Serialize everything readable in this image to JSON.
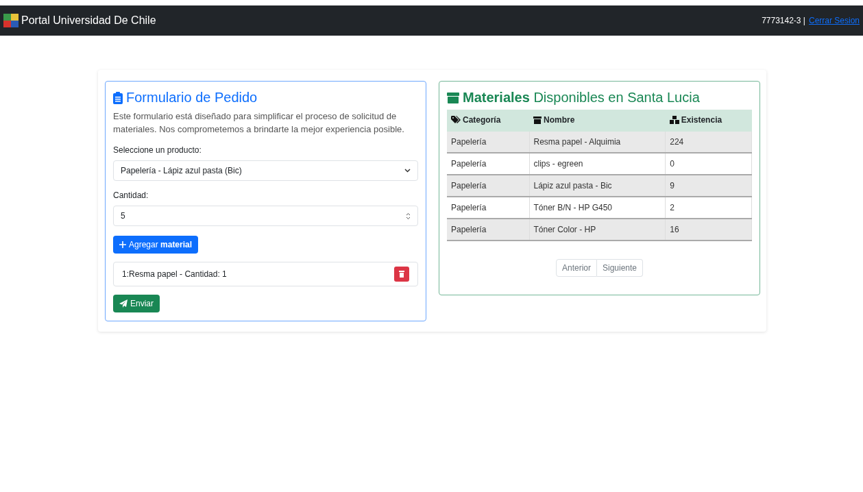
{
  "navbar": {
    "brand": "Portal Universidad De Chile",
    "user": "7773142-3 |",
    "logout": "Cerrar Sesion"
  },
  "form": {
    "title": "Formulario de Pedido",
    "description": "Este formulario está diseñado para simplificar el proceso de solicitud de materiales. Nos comprometemos a brindarte la mejor experiencia posible.",
    "product_label": "Seleccione un producto:",
    "product_value": "Papelería - Lápiz azul pasta (Bic)",
    "quantity_label": "Cantidad:",
    "quantity_value": "5",
    "add_button": "Agregar **material**",
    "items": [
      "1:Resma papel - Cantidad: 1"
    ],
    "submit_button": "Enviar"
  },
  "materials": {
    "title": "**Materiales** Disponibles en Santa Lucia",
    "columns": [
      "Categoría",
      "Nombre",
      "Existencia"
    ],
    "rows": [
      [
        "Papelería",
        "Resma papel - Alquimia",
        "224"
      ],
      [
        "Papelería",
        "clips - egreen",
        "0"
      ],
      [
        "Papelería",
        "Lápiz azul pasta - Bic",
        "9"
      ],
      [
        "Papelería",
        "Tóner B/N - HP G450",
        "2"
      ],
      [
        "Papelería",
        "Tóner Color - HP",
        "16"
      ]
    ],
    "pagination": [
      {
        "label": "Anterior",
        "disabled": true
      },
      {
        "label": "Siguiente",
        "disabled": true
      }
    ]
  }
}
